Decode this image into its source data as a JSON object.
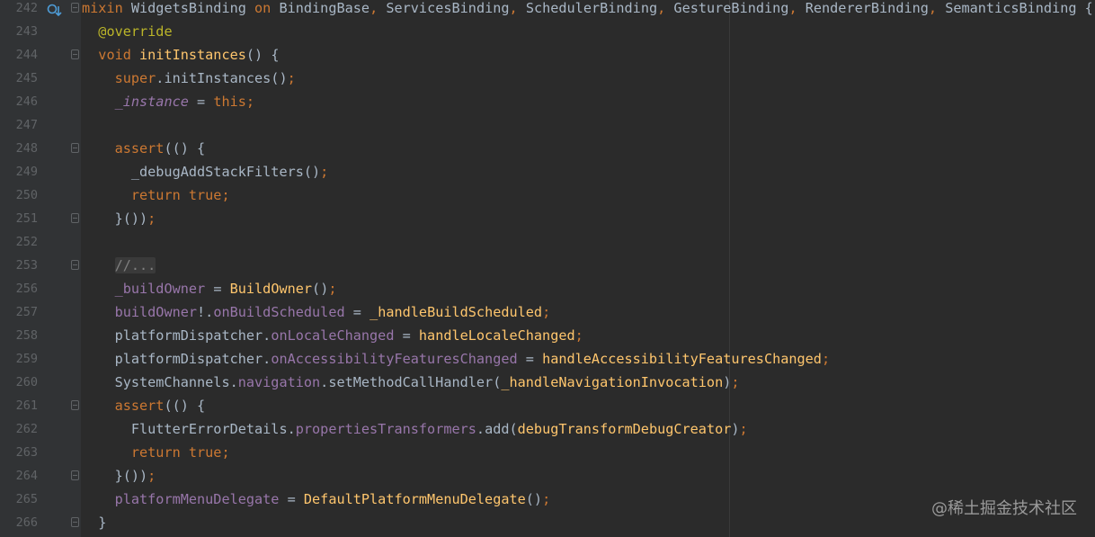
{
  "editor": {
    "lines": [
      {
        "num": "242",
        "tokens": [
          [
            "kw",
            "mixin "
          ],
          [
            "sym",
            "WidgetsBinding "
          ],
          [
            "kw",
            "on "
          ],
          [
            "sym",
            "BindingBase"
          ],
          [
            "kw",
            ", "
          ],
          [
            "sym",
            "ServicesBinding"
          ],
          [
            "kw",
            ", "
          ],
          [
            "sym",
            "SchedulerBinding"
          ],
          [
            "kw",
            ", "
          ],
          [
            "sym",
            "GestureBinding"
          ],
          [
            "kw",
            ", "
          ],
          [
            "sym",
            "RendererBinding"
          ],
          [
            "kw",
            ", "
          ],
          [
            "sym",
            "SemanticsBinding {"
          ]
        ]
      },
      {
        "num": "243",
        "tokens": [
          [
            "sym",
            "  "
          ],
          [
            "ann",
            "@override"
          ]
        ]
      },
      {
        "num": "244",
        "tokens": [
          [
            "sym",
            "  "
          ],
          [
            "kw",
            "void "
          ],
          [
            "fn",
            "initInstances"
          ],
          [
            "sym",
            "() {"
          ]
        ]
      },
      {
        "num": "245",
        "tokens": [
          [
            "sym",
            "    "
          ],
          [
            "kw",
            "super"
          ],
          [
            "sym",
            ".initInstances()"
          ],
          [
            "kw",
            ";"
          ]
        ]
      },
      {
        "num": "246",
        "tokens": [
          [
            "sym",
            "    "
          ],
          [
            "fieldi",
            "_instance"
          ],
          [
            "sym",
            " = "
          ],
          [
            "kw",
            "this;"
          ]
        ]
      },
      {
        "num": "247",
        "tokens": []
      },
      {
        "num": "248",
        "tokens": [
          [
            "sym",
            "    "
          ],
          [
            "kw",
            "assert"
          ],
          [
            "sym",
            "(() {"
          ]
        ]
      },
      {
        "num": "249",
        "tokens": [
          [
            "sym",
            "      _debugAddStackFilters()"
          ],
          [
            "kw",
            ";"
          ]
        ]
      },
      {
        "num": "250",
        "tokens": [
          [
            "sym",
            "      "
          ],
          [
            "kw",
            "return true;"
          ]
        ]
      },
      {
        "num": "251",
        "tokens": [
          [
            "sym",
            "    }())"
          ],
          [
            "kw",
            ";"
          ]
        ]
      },
      {
        "num": "252",
        "tokens": []
      },
      {
        "num": "253",
        "tokens": [
          [
            "sym",
            "    "
          ],
          [
            "cmtbox",
            "//..."
          ]
        ]
      },
      {
        "num": "256",
        "tokens": [
          [
            "sym",
            "    "
          ],
          [
            "field",
            "_buildOwner"
          ],
          [
            "sym",
            " = "
          ],
          [
            "fn",
            "BuildOwner"
          ],
          [
            "sym",
            "()"
          ],
          [
            "kw",
            ";"
          ]
        ]
      },
      {
        "num": "257",
        "tokens": [
          [
            "sym",
            "    "
          ],
          [
            "field",
            "buildOwner"
          ],
          [
            "sym",
            "!."
          ],
          [
            "field",
            "onBuildScheduled"
          ],
          [
            "sym",
            " = "
          ],
          [
            "fn",
            "_handleBuildScheduled"
          ],
          [
            "kw",
            ";"
          ]
        ]
      },
      {
        "num": "258",
        "tokens": [
          [
            "sym",
            "    platformDispatcher."
          ],
          [
            "field",
            "onLocaleChanged"
          ],
          [
            "sym",
            " = "
          ],
          [
            "fn",
            "handleLocaleChanged"
          ],
          [
            "kw",
            ";"
          ]
        ]
      },
      {
        "num": "259",
        "tokens": [
          [
            "sym",
            "    platformDispatcher."
          ],
          [
            "field",
            "onAccessibilityFeaturesChanged"
          ],
          [
            "sym",
            " = "
          ],
          [
            "fn",
            "handleAccessibilityFeaturesChanged"
          ],
          [
            "kw",
            ";"
          ]
        ]
      },
      {
        "num": "260",
        "tokens": [
          [
            "sym",
            "    SystemChannels."
          ],
          [
            "field",
            "navigation"
          ],
          [
            "sym",
            ".setMethodCallHandler("
          ],
          [
            "fn",
            "_handleNavigationInvocation"
          ],
          [
            "sym",
            ")"
          ],
          [
            "kw",
            ";"
          ]
        ]
      },
      {
        "num": "261",
        "tokens": [
          [
            "sym",
            "    "
          ],
          [
            "kw",
            "assert"
          ],
          [
            "sym",
            "(() {"
          ]
        ]
      },
      {
        "num": "262",
        "tokens": [
          [
            "sym",
            "      FlutterErrorDetails."
          ],
          [
            "field",
            "propertiesTransformers"
          ],
          [
            "sym",
            ".add("
          ],
          [
            "fn",
            "debugTransformDebugCreator"
          ],
          [
            "sym",
            ")"
          ],
          [
            "kw",
            ";"
          ]
        ]
      },
      {
        "num": "263",
        "tokens": [
          [
            "sym",
            "      "
          ],
          [
            "kw",
            "return true;"
          ]
        ]
      },
      {
        "num": "264",
        "tokens": [
          [
            "sym",
            "    }())"
          ],
          [
            "kw",
            ";"
          ]
        ]
      },
      {
        "num": "265",
        "tokens": [
          [
            "sym",
            "    "
          ],
          [
            "field",
            "platformMenuDelegate"
          ],
          [
            "sym",
            " = "
          ],
          [
            "fn",
            "DefaultPlatformMenuDelegate"
          ],
          [
            "sym",
            "()"
          ],
          [
            "kw",
            ";"
          ]
        ]
      },
      {
        "num": "266",
        "tokens": [
          [
            "sym",
            "  }"
          ]
        ]
      }
    ],
    "fold_lines": [
      "242",
      "244",
      "248",
      "251",
      "253",
      "261",
      "264",
      "266"
    ]
  },
  "watermark": "@稀土掘金技术社区"
}
